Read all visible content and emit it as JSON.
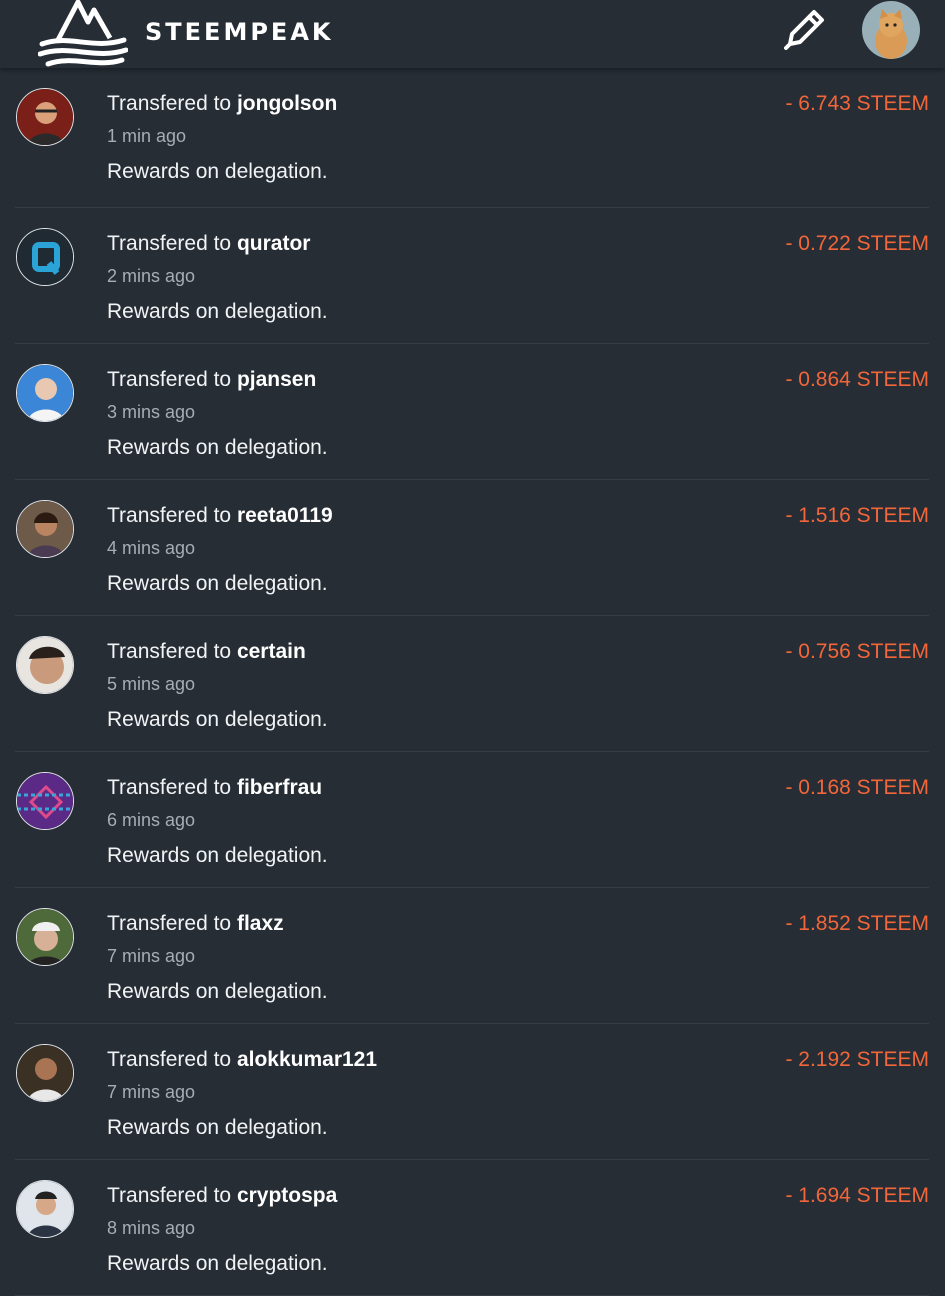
{
  "header": {
    "brand": "STEEMPEAK",
    "logo_icon": "mountain-logo-icon",
    "compose_icon": "pencil-icon",
    "user_avatar_icon": "kitten-avatar"
  },
  "colors": {
    "background": "#262d35",
    "amount": "#f2663a",
    "secondary_text": "#a5adb6"
  },
  "transfers": [
    {
      "prefix": "Transfered to ",
      "user": "jongolson",
      "time": "1 min ago",
      "memo": "Rewards on delegation.",
      "amount": "- 6.743 STEEM"
    },
    {
      "prefix": "Transfered to ",
      "user": "qurator",
      "time": "2 mins ago",
      "memo": "Rewards on delegation.",
      "amount": "- 0.722 STEEM"
    },
    {
      "prefix": "Transfered to ",
      "user": "pjansen",
      "time": "3 mins ago",
      "memo": "Rewards on delegation.",
      "amount": "- 0.864 STEEM"
    },
    {
      "prefix": "Transfered to ",
      "user": "reeta0119",
      "time": "4 mins ago",
      "memo": "Rewards on delegation.",
      "amount": "- 1.516 STEEM"
    },
    {
      "prefix": "Transfered to ",
      "user": "certain",
      "time": "5 mins ago",
      "memo": "Rewards on delegation.",
      "amount": "- 0.756 STEEM"
    },
    {
      "prefix": "Transfered to ",
      "user": "fiberfrau",
      "time": "6 mins ago",
      "memo": "Rewards on delegation.",
      "amount": "- 0.168 STEEM"
    },
    {
      "prefix": "Transfered to ",
      "user": "flaxz",
      "time": "7 mins ago",
      "memo": "Rewards on delegation.",
      "amount": "- 1.852 STEEM"
    },
    {
      "prefix": "Transfered to ",
      "user": "alokkumar121",
      "time": "7 mins ago",
      "memo": "Rewards on delegation.",
      "amount": "- 2.192 STEEM"
    },
    {
      "prefix": "Transfered to ",
      "user": "cryptospa",
      "time": "8 mins ago",
      "memo": "Rewards on delegation.",
      "amount": "- 1.694 STEEM"
    }
  ]
}
